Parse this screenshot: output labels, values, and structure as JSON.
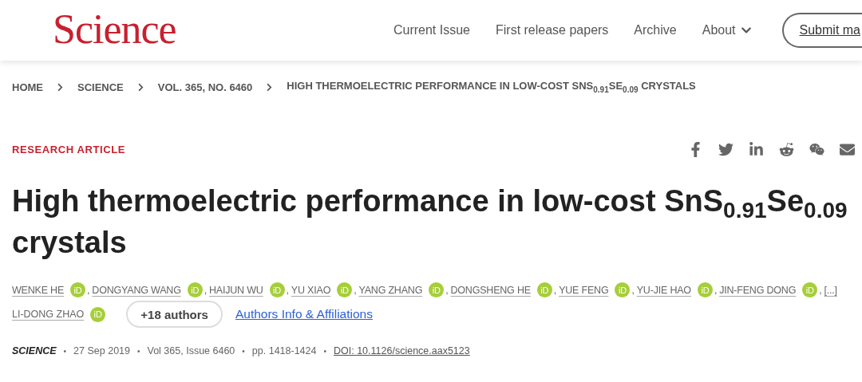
{
  "header": {
    "logo": "Science",
    "nav": [
      {
        "label": "Current Issue",
        "dropdown": false
      },
      {
        "label": "First release papers",
        "dropdown": false
      },
      {
        "label": "Archive",
        "dropdown": false
      },
      {
        "label": "About",
        "dropdown": true
      }
    ],
    "submit_button": "Submit ma"
  },
  "breadcrumb": [
    "HOME",
    "SCIENCE",
    "VOL. 365, NO. 6460",
    "HIGH THERMOELECTRIC PERFORMANCE IN LOW-COST SNS$_{0.91}$SE$_{0.09}$ CRYSTALS"
  ],
  "article_type": "RESEARCH ARTICLE",
  "share": [
    {
      "kind": "facebook"
    },
    {
      "kind": "twitter"
    },
    {
      "kind": "linkedin"
    },
    {
      "kind": "reddit"
    },
    {
      "kind": "wechat"
    },
    {
      "kind": "mail"
    }
  ],
  "title": "High thermoelectric performance in low-cost SnS$_{0.91}$Se$_{0.09}$ crystals",
  "authors": [
    {
      "name": "WENKE HE",
      "orcid": "iD",
      "sep": ","
    },
    {
      "name": "DONGYANG WANG",
      "orcid": "iD",
      "sep": ","
    },
    {
      "name": "HAIJUN WU",
      "orcid": "iD",
      "sep": ","
    },
    {
      "name": "YU XIAO",
      "orcid": "iD",
      "sep": ","
    },
    {
      "name": "YANG ZHANG",
      "orcid": "iD",
      "sep": ","
    },
    {
      "name": "DONGSHENG HE",
      "orcid": "iD",
      "sep": ","
    },
    {
      "name": "YUE FENG",
      "orcid": "iD",
      "sep": ","
    },
    {
      "name": "YU-JIE HAO",
      "orcid": "iD",
      "sep": ","
    },
    {
      "name": "JIN-FENG DONG",
      "orcid": "iD",
      "sep": ","
    }
  ],
  "more_link": "[...]",
  "last_author": {
    "name": "LI-DONG ZHAO",
    "orcid": "iD"
  },
  "more_authors_button": "+18 authors",
  "affiliations_link": "Authors Info & Affiliations",
  "meta": {
    "separator": "•",
    "items": [
      {
        "kind": "journal",
        "text": "SCIENCE"
      },
      {
        "kind": "text",
        "text": "27 Sep 2019"
      },
      {
        "kind": "text",
        "text": "Vol 365, Issue 6460"
      },
      {
        "kind": "text",
        "text": "pp. 1418-1424"
      },
      {
        "kind": "link",
        "text": "DOI: 10.1126/science.aax5123"
      }
    ]
  }
}
